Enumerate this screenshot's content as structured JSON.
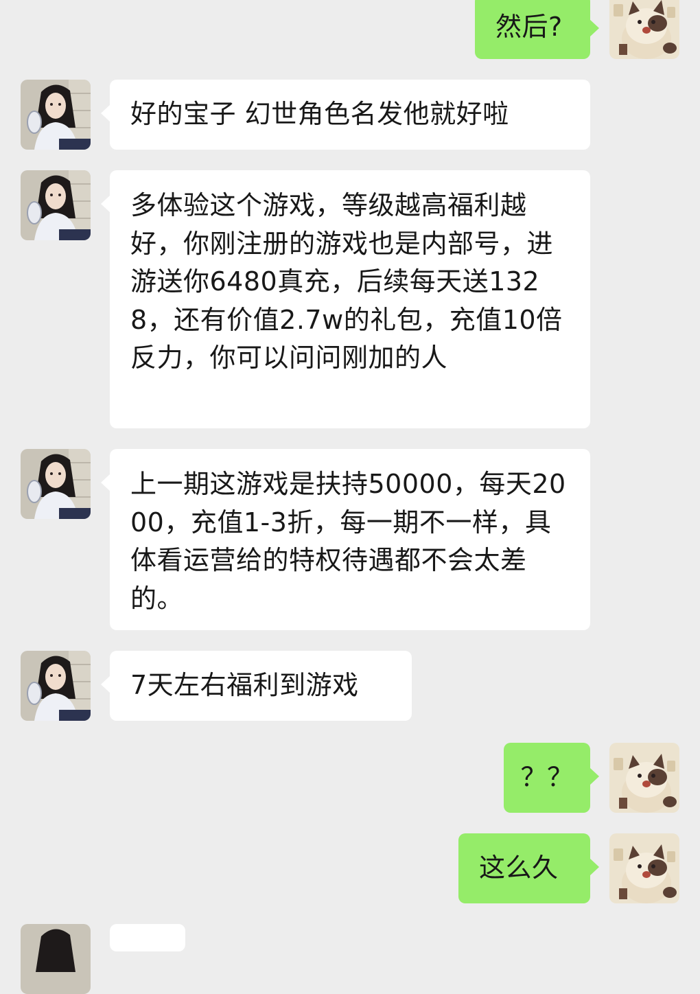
{
  "conversation": {
    "messages": [
      {
        "side": "out",
        "sender": "me",
        "text": "然后?"
      },
      {
        "side": "in",
        "sender": "contact",
        "text": "好的宝子 幻世角色名发他就好啦"
      },
      {
        "side": "in",
        "sender": "contact",
        "text": "多体验这个游戏，等级越高福利越好，你刚注册的游戏也是内部号，进游送你6480真充，后续每天送1328，还有价值2.7w的礼包，充值10倍反力，你可以问问刚加的人"
      },
      {
        "side": "in",
        "sender": "contact",
        "text": "上一期这游戏是扶持50000，每天2000，充值1-3折，每一期不一样，具体看运营给的特权待遇都不会太差的。"
      },
      {
        "side": "in",
        "sender": "contact",
        "text": "7天左右福利到游戏"
      },
      {
        "side": "out",
        "sender": "me",
        "text": "？？"
      },
      {
        "side": "out",
        "sender": "me",
        "text": "这么久"
      }
    ]
  },
  "colors": {
    "background": "#ededed",
    "incoming_bubble": "#ffffff",
    "outgoing_bubble": "#95ec69",
    "text": "#181818"
  },
  "icons": {
    "contact_avatar": "girl-photo-avatar",
    "my_avatar": "cartoon-cat-avatar"
  }
}
